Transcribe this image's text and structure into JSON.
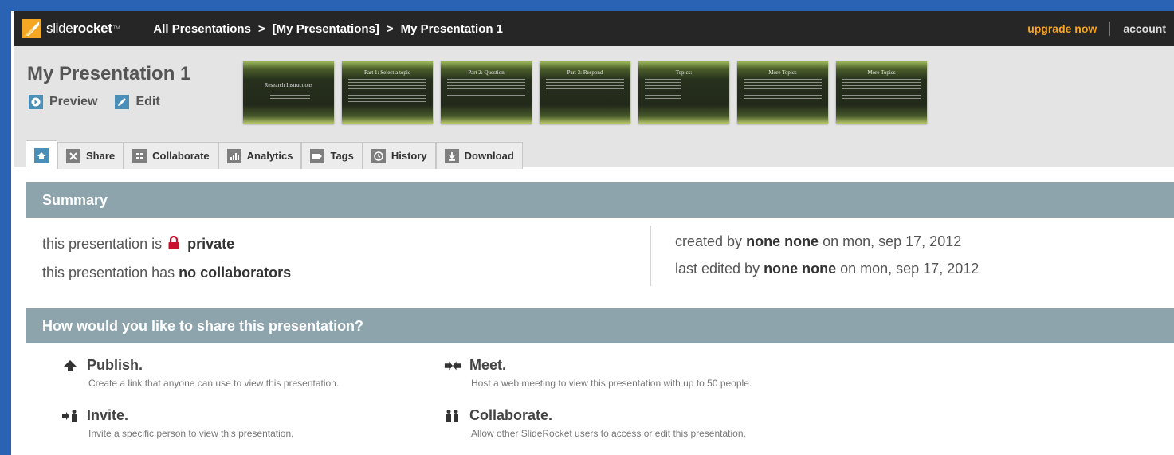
{
  "topbar": {
    "logo_light": "slide",
    "logo_bold": "rocket",
    "logo_tm": "TM",
    "breadcrumbs": [
      "All Presentations",
      "[My Presentations]",
      "My Presentation 1"
    ],
    "separator": ">",
    "upgrade_label": "upgrade now",
    "account_label": "account"
  },
  "presentation": {
    "title": "My Presentation 1",
    "preview_label": "Preview",
    "edit_label": "Edit",
    "slides": [
      {
        "title": "Research Instructions"
      },
      {
        "title": "Part 1: Select a topic"
      },
      {
        "title": "Part 2: Question"
      },
      {
        "title": "Part 3: Respond"
      },
      {
        "title": "Topics:"
      },
      {
        "title": "More Topics"
      },
      {
        "title": "More Topics"
      }
    ]
  },
  "tabs": {
    "home_icon": "home-icon",
    "items": [
      {
        "label": "Share",
        "icon": "share-icon"
      },
      {
        "label": "Collaborate",
        "icon": "collaborate-icon"
      },
      {
        "label": "Analytics",
        "icon": "analytics-icon"
      },
      {
        "label": "Tags",
        "icon": "tag-icon"
      },
      {
        "label": "History",
        "icon": "clock-icon"
      },
      {
        "label": "Download",
        "icon": "download-icon"
      }
    ]
  },
  "summary": {
    "heading": "Summary",
    "privacy_prefix": "this presentation is",
    "privacy_value": "private",
    "collab_prefix": "this presentation has",
    "collab_value": "no collaborators",
    "created_prefix": "created by",
    "created_by": "none none",
    "created_on": "on mon, sep 17, 2012",
    "edited_prefix": "last edited by",
    "edited_by": "none none",
    "edited_on": "on mon, sep 17, 2012"
  },
  "share": {
    "heading": "How would you like to share this presentation?",
    "options": [
      {
        "title": "Publish.",
        "desc": "Create a link that anyone can use to view this presentation."
      },
      {
        "title": "Meet.",
        "desc": "Host a web meeting to view this presentation with up to 50 people."
      },
      {
        "title": "Invite.",
        "desc": "Invite a specific person to view this presentation."
      },
      {
        "title": "Collaborate.",
        "desc": "Allow other SlideRocket users to access or edit this presentation."
      }
    ]
  },
  "colors": {
    "frame": "#2a62b4",
    "topbar": "#262626",
    "accent": "#f5a623",
    "section_bar": "#8da4ad",
    "lock": "#c8102e"
  }
}
